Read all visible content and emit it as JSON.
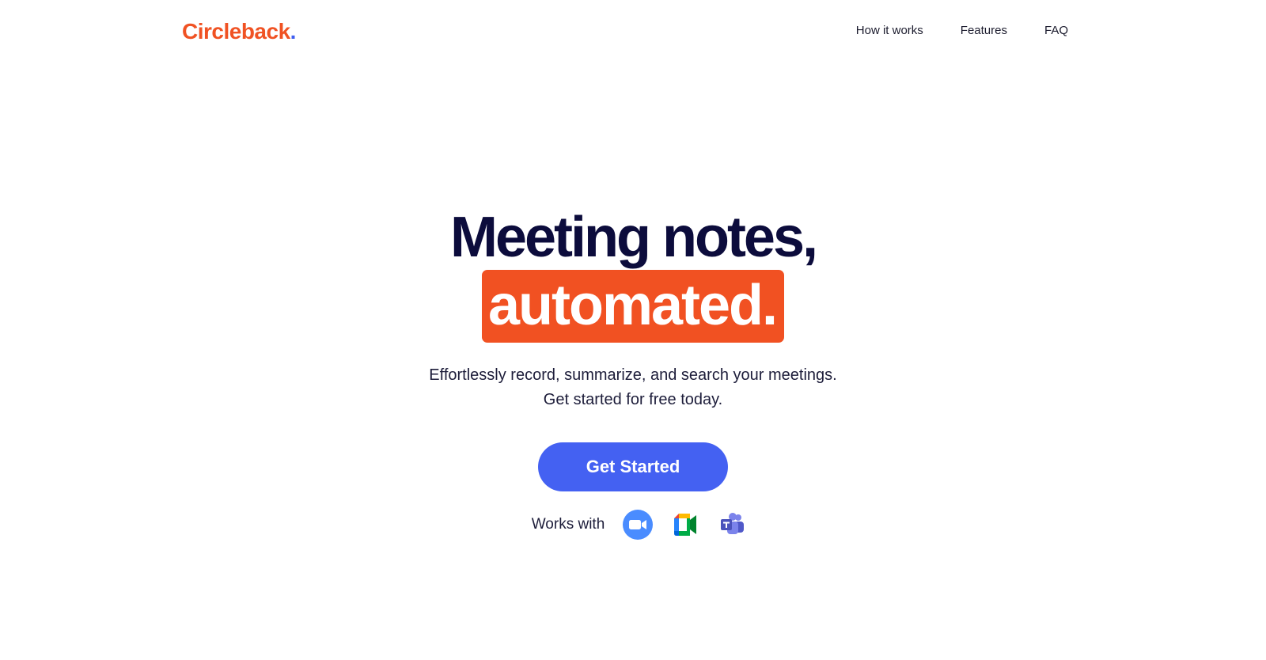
{
  "header": {
    "logo_text": "Circleback",
    "logo_dot": ".",
    "nav": [
      {
        "label": "How it works"
      },
      {
        "label": "Features"
      },
      {
        "label": "FAQ"
      }
    ]
  },
  "hero": {
    "headline_line1": "Meeting notes,",
    "headline_line2": "automated.",
    "subtitle_line1": "Effortlessly record, summarize, and search your meetings.",
    "subtitle_line2": "Get started for free today.",
    "cta_label": "Get Started",
    "works_with_label": "Works with",
    "integrations": [
      {
        "icon": "zoom-icon"
      },
      {
        "icon": "google-meet-icon"
      },
      {
        "icon": "microsoft-teams-icon"
      }
    ]
  },
  "colors": {
    "brand_orange": "#f15122",
    "brand_blue": "#4461f2",
    "headline_navy": "#0c0c3c"
  }
}
